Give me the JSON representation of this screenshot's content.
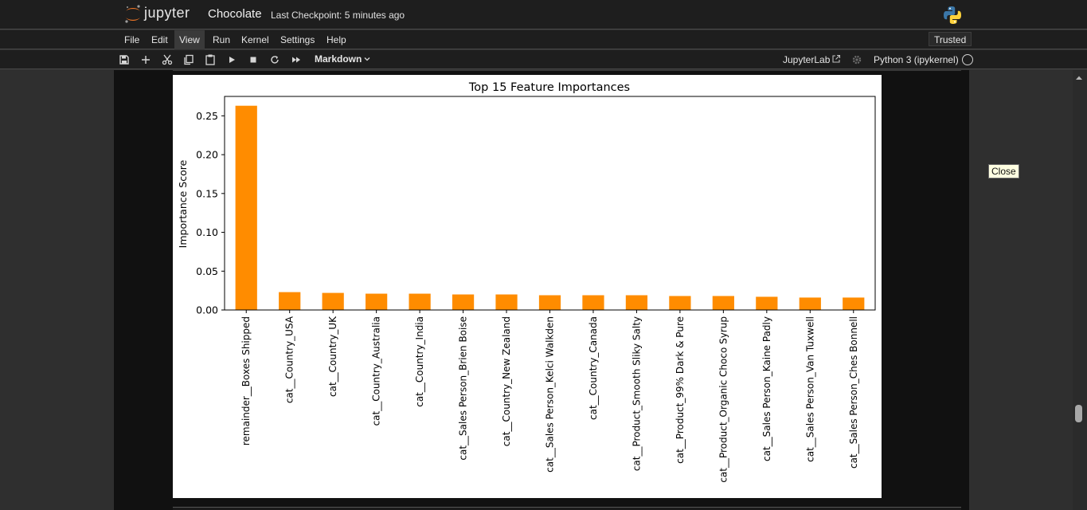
{
  "header": {
    "logo_text": "jupyter",
    "notebook_title": "Chocolate",
    "checkpoint": "Last Checkpoint: 5 minutes ago"
  },
  "menu": {
    "items": [
      "File",
      "Edit",
      "View",
      "Run",
      "Kernel",
      "Settings",
      "Help"
    ],
    "active": "View",
    "trusted": "Trusted"
  },
  "toolbar": {
    "icons": [
      "save-icon",
      "add-cell-icon",
      "cut-icon",
      "copy-icon",
      "paste-icon",
      "run-icon",
      "stop-icon",
      "restart-icon",
      "fast-forward-icon"
    ],
    "cell_type": "Markdown",
    "jupyterlab_link": "JupyterLab",
    "kernel_name": "Python 3 (ipykernel)"
  },
  "tooltip": "Close",
  "colors": {
    "bar": "#ff8c00",
    "background": "#111111",
    "topbar": "#1e1e1e"
  },
  "chart_data": {
    "type": "bar",
    "title": "Top 15 Feature Importances",
    "xlabel": "",
    "ylabel": "Importance Score",
    "ylim": [
      0,
      0.275
    ],
    "yticks": [
      "0.00",
      "0.05",
      "0.10",
      "0.15",
      "0.20",
      "0.25"
    ],
    "categories": [
      "remainder__Boxes Shipped",
      "cat__Country_USA",
      "cat__Country_UK",
      "cat__Country_Australia",
      "cat__Country_India",
      "cat__Sales Person_Brien Boise",
      "cat__Country_New Zealand",
      "cat__Sales Person_Kelci Walkden",
      "cat__Country_Canada",
      "cat__Product_Smooth Sliky Salty",
      "cat__Product_99% Dark & Pure",
      "cat__Product_Organic Choco Syrup",
      "cat__Sales Person_Kaine Padly",
      "cat__Sales Person_Van Tuxwell",
      "cat__Sales Person_Ches Bonnell"
    ],
    "values": [
      0.263,
      0.023,
      0.022,
      0.021,
      0.021,
      0.02,
      0.02,
      0.019,
      0.019,
      0.019,
      0.018,
      0.018,
      0.017,
      0.016,
      0.016
    ],
    "grid": false
  }
}
